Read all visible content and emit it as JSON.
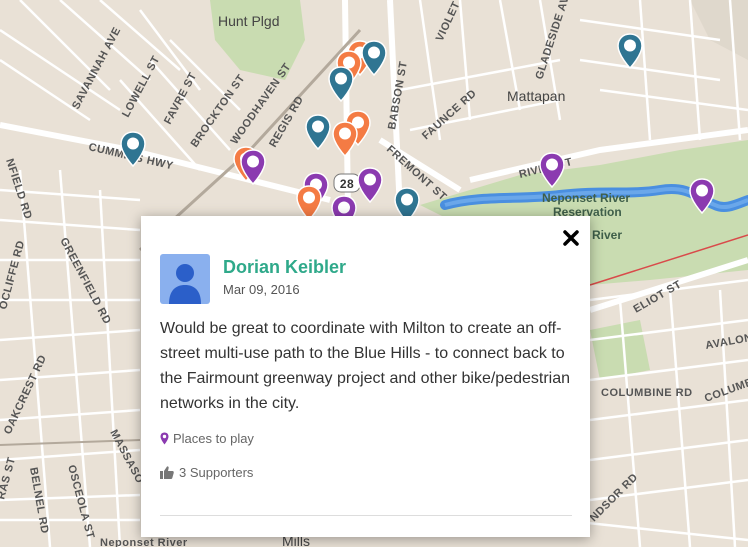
{
  "map": {
    "labels": {
      "hunt_plgd": "Hunt Plgd",
      "mattapan": "Mattapan",
      "neponset_res_1": "Neponset River",
      "neponset_res_2": "Reservation",
      "river_frag": "River",
      "cummins": "CUMMINS HWY",
      "savannah": "SAVANNAH AVE",
      "lowell": "LOWELL ST",
      "favre": "FAVRE ST",
      "brockton": "BROCKTON ST",
      "woodhaven": "WOODHAVEN ST",
      "regis": "REGIS RD",
      "babson": "BABSON ST",
      "fremont": "FREMONT ST",
      "faunce": "FAUNCE RD",
      "violet": "VIOLET ST",
      "gladeside": "GLADESIDE AVE",
      "river_st": "RIVER ST",
      "greenfield": "GREENFIELD RD",
      "infield": "NFIELD RD",
      "ocliffe": "OCLIFFE RD",
      "oakcrest": "OAKCREST RD",
      "belnel": "BELNEL RD",
      "osceola": "OSCEOLA ST",
      "ras": "RAS ST",
      "massasoit": "MASSASO",
      "eliot": "ELIOT ST",
      "avalon": "AVALON",
      "columbine_rd": "COLUMBINE RD",
      "columbine_2": "COLUMB",
      "ndsor": "NDSOR RD",
      "route_28": "28",
      "mills": "Mills",
      "neponset_bottom": "Neponset River"
    },
    "marker_colors": {
      "orange": "#f47b44",
      "teal": "#2f7592",
      "purple": "#8b3ab0"
    }
  },
  "popup": {
    "close_label": "×",
    "author": "Dorian Keibler",
    "date": "Mar 09, 2016",
    "comment": "Would be great to coordinate with Milton to create an off-street multi-use path to the Blue Hills - to connect back to the Fairmount greenway project and other bike/pedestrian networks in the city.",
    "category": "Places to play",
    "supporters": "3 Supporters"
  }
}
